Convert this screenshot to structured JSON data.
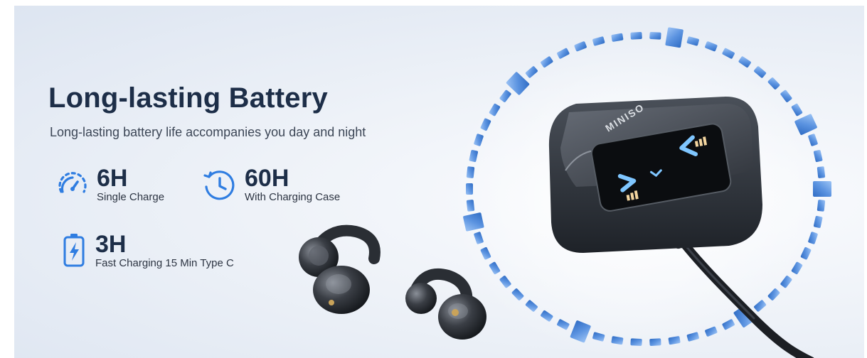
{
  "banner": {
    "title": "Long-lasting Battery",
    "subtitle": "Long-lasting battery life accompanies you day and night"
  },
  "features": [
    {
      "icon": "speedometer-icon",
      "value": "6H",
      "label": "Single Charge"
    },
    {
      "icon": "clock-icon",
      "value": "60H",
      "label": "With Charging Case"
    },
    {
      "icon": "battery-charging-icon",
      "value": "3H",
      "label": "Fast Charging 15 Min Type C"
    }
  ],
  "product": {
    "brand": "MINISO"
  },
  "colors": {
    "accent": "#2f7de1",
    "title": "#1d2e48",
    "ring_blocks": "#5a8fd8",
    "case_body": "#2b2f36"
  }
}
